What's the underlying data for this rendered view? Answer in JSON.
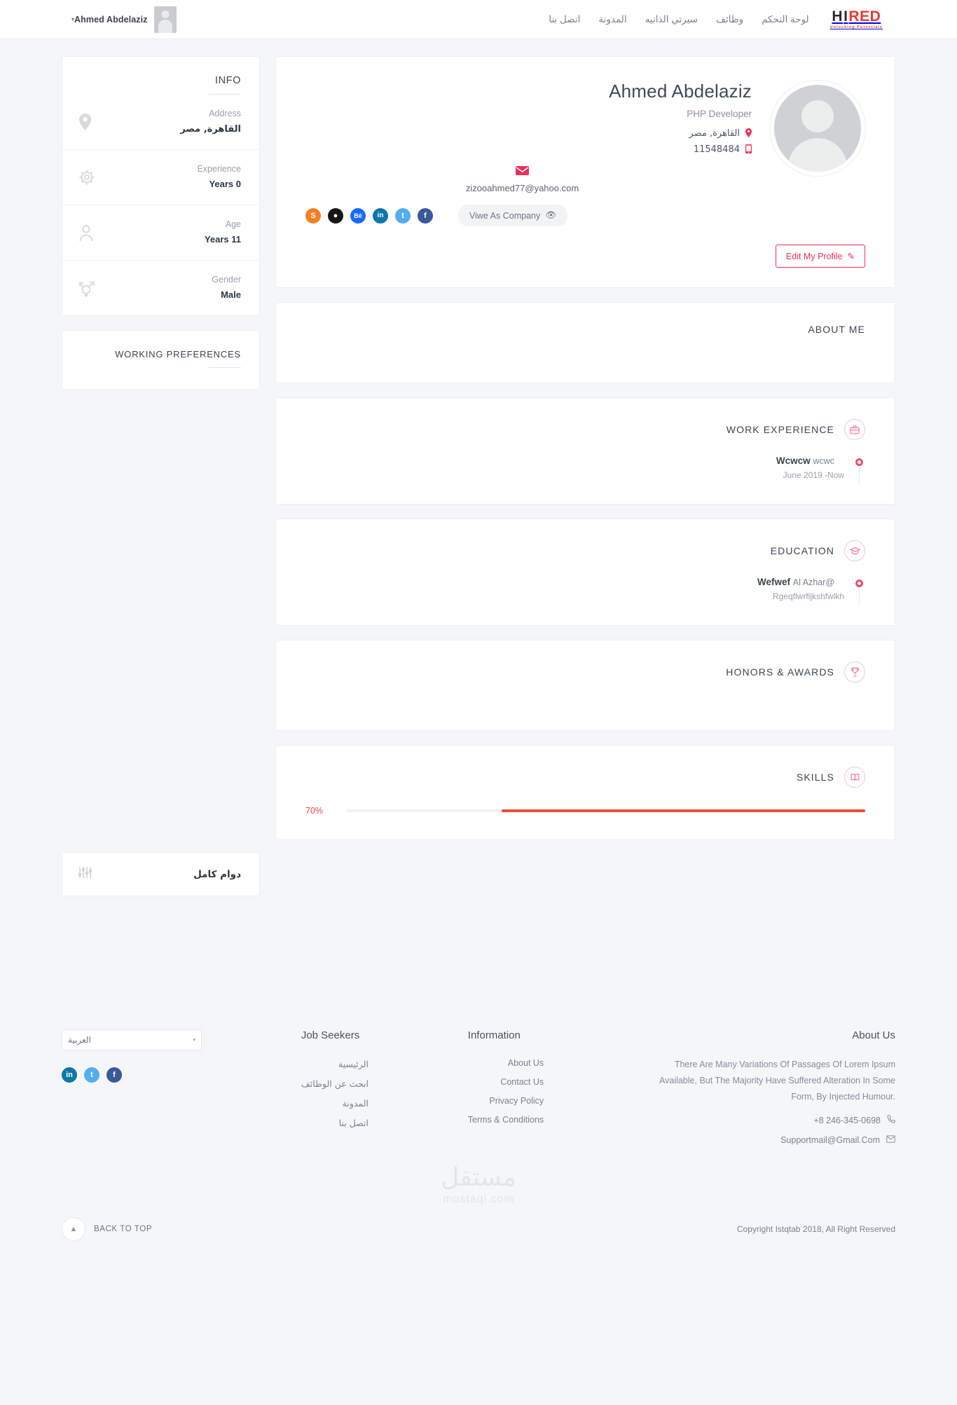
{
  "header": {
    "user_name": "Ahmed Abdelaziz",
    "caret": "▾",
    "nav": [
      {
        "label": "لوحة التحكم"
      },
      {
        "label": "وظائف"
      },
      {
        "label": "سيرتي الذاتيه"
      },
      {
        "label": "المدونة"
      },
      {
        "label": "اتصل بنا"
      }
    ],
    "logo": {
      "part1": "H",
      "part2": "I",
      "part3": "RED",
      "tagline": "Unlocking Potentials"
    }
  },
  "info_card": {
    "title": "INFO",
    "rows": [
      {
        "icon": "map-pin-icon",
        "label": "Address",
        "value": "القاهرة, مصر",
        "rtl": true
      },
      {
        "icon": "gear-icon",
        "label": "Experience",
        "value": "Years 0",
        "rtl": false
      },
      {
        "icon": "person-icon",
        "label": "Age",
        "value": "Years 11",
        "rtl": false
      },
      {
        "icon": "gender-icon",
        "label": "Gender",
        "value": "Male",
        "rtl": false
      }
    ]
  },
  "working_preferences": {
    "title": "WORKING PREFERENCES",
    "rows": [
      {
        "icon": "sliders-icon",
        "value": "دوام كامل"
      }
    ]
  },
  "profile": {
    "name": "Ahmed Abdelaziz",
    "role": "PHP Developer",
    "location": "القاهرة, مصر",
    "phone": "11548484",
    "email": "zizooahmed77@yahoo.com",
    "socials": [
      {
        "name": "stackoverflow-icon",
        "glyph": "S"
      },
      {
        "name": "github-icon",
        "glyph": "●"
      },
      {
        "name": "behance-icon",
        "glyph": "Bē"
      },
      {
        "name": "linkedin-icon",
        "glyph": "in"
      },
      {
        "name": "twitter-icon",
        "glyph": "t"
      },
      {
        "name": "facebook-icon",
        "glyph": "f"
      }
    ],
    "view_as_company_label": "Viwe As Company",
    "eye_icon": "👁",
    "edit_profile_label": "Edit My Profile",
    "edit_icon": "✎"
  },
  "sections": {
    "about_me": {
      "title": "ABOUT ME",
      "badge_icon": "",
      "items": []
    },
    "work_experience": {
      "title": "WORK EXPERIENCE",
      "badge_icon": "💼",
      "items": [
        {
          "title": "Wcwcw",
          "subtitle": "wcwc",
          "meta": "June 2019 -Now"
        }
      ]
    },
    "education": {
      "title": "EDUCATION",
      "badge_icon": "🎓",
      "items": [
        {
          "title": "Wefwef",
          "subtitle": "Al Azhar@",
          "meta": "Rgeqflwrfljkshfwlkh"
        }
      ]
    },
    "honors_awards": {
      "title": "HONORS & AWARDS",
      "badge_icon": "🏆",
      "items": []
    },
    "skills": {
      "title": "SKILLS",
      "badge_icon": "📖",
      "items": [
        {
          "percent_label": "70%",
          "percent": 70
        }
      ]
    }
  },
  "footer": {
    "language_select": {
      "value": "العربية",
      "caret": "▾"
    },
    "social": [
      {
        "name": "linkedin-icon",
        "glyph": "in",
        "color": "#0e76a8"
      },
      {
        "name": "twitter-icon",
        "glyph": "t",
        "color": "#55acee"
      },
      {
        "name": "facebook-icon",
        "glyph": "f",
        "color": "#3b5998"
      }
    ],
    "job_seekers": {
      "title": "Job Seekers",
      "links": [
        "الرئيسية",
        "ابحث عن الوظائف",
        "المدونة",
        "اتصل بنا"
      ]
    },
    "information": {
      "title": "Information",
      "links": [
        "About Us",
        "Contact Us",
        "Privacy Policy",
        "Terms & Conditions"
      ]
    },
    "about_us": {
      "title": "About Us",
      "text": "There Are Many Variations Of Passages Of Lorem Ipsum Available, But The Majority Have Suffered Alteration In Some Form, By Injected Humour.",
      "phone": "+8 246-345-0698",
      "email": "Supportmail@Gmail.Com"
    },
    "watermark": {
      "arabic": "مستقل",
      "latin": "mostaql.com"
    },
    "back_to_top": {
      "label": "BACK TO TOP",
      "icon": "▲"
    },
    "copyright": "Copyright Istqtab 2018, All Right Reserved"
  }
}
